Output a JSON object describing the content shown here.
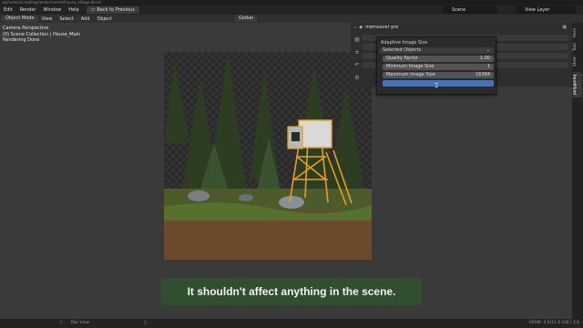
{
  "window": {
    "title_path": "apt/videos/creating/render/coords/house_village.blend"
  },
  "menubar": {
    "items": [
      "Edit",
      "Render",
      "Window",
      "Help"
    ],
    "back_button": "Back to Previous",
    "scene": "Scene",
    "view_layer": "View Layer"
  },
  "header": {
    "mode": "Object Mode",
    "menus": [
      "View",
      "Select",
      "Add",
      "Object"
    ],
    "transform_orientation": "Global"
  },
  "viewport_overlay": {
    "line1": "Camera Perspective",
    "line2": "(0) Scene Collection | House_Main",
    "line3": "Rendering Done"
  },
  "addon": {
    "name": "memsaver pro"
  },
  "popup": {
    "title": "Adaptive Image Size",
    "dropdown": "Selected Objects",
    "quality_label": "Quality Factor",
    "quality_value": "1.00",
    "min_label": "Minimum Image Size",
    "min_value": "1",
    "max_label": "Maximum Image Size",
    "max_value": "16384"
  },
  "sidebar_tabs": [
    "Item",
    "Tool",
    "View",
    "polygoniq"
  ],
  "subtitle": "It shouldn't affect anything in the scene.",
  "status": {
    "left": "Pan View",
    "right": "VRAM: 4.6/11.0 GiB | 3.6"
  },
  "colors": {
    "accent": "#4772b3",
    "subtitle_bg": "#2f4f2f",
    "tower": "#e6a020"
  }
}
